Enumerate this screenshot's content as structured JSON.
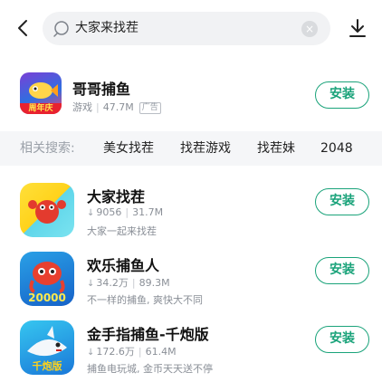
{
  "search": {
    "query": "大家来找茬"
  },
  "featured_app": {
    "title": "哥哥捕鱼",
    "category": "游戏",
    "size": "47.7M",
    "ad_tag": "广告",
    "install_label": "安装",
    "icon_caption": "周年庆"
  },
  "related": {
    "label": "相关搜索:",
    "items": [
      "美女找茬",
      "找茬游戏",
      "找茬妹",
      "2048"
    ]
  },
  "apps": [
    {
      "title": "大家找茬",
      "downloads": "9056",
      "size": "31.7M",
      "desc": "大家一起来找茬",
      "install_label": "安装",
      "icon_caption": ""
    },
    {
      "title": "欢乐捕鱼人",
      "downloads": "34.2万",
      "size": "89.3M",
      "desc": "不一样的捕鱼, 爽快大不同",
      "install_label": "安装",
      "icon_caption": "20000"
    },
    {
      "title": "金手指捕鱼-千炮版",
      "downloads": "172.6万",
      "size": "61.4M",
      "desc": "捕鱼电玩城, 金币天天送不停",
      "install_label": "安装",
      "icon_caption": "千炮版"
    }
  ],
  "colors": {
    "accent": "#1aa37a",
    "related_bg": "#f5f6f8",
    "search_bg": "#f1f2f4"
  }
}
